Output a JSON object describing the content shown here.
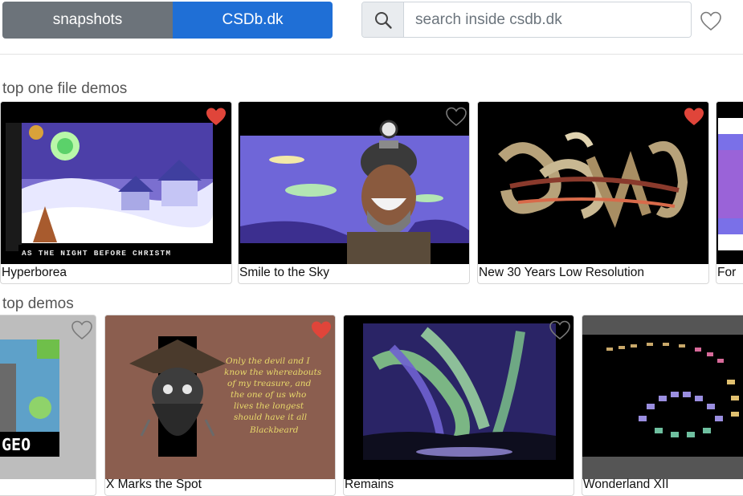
{
  "header": {
    "snapshots_label": "snapshots",
    "csdb_label": "CSDb.dk",
    "search_placeholder": "search inside csdb.dk"
  },
  "sections": [
    {
      "title": "top one file demos",
      "items": [
        {
          "title": "Hyperborea",
          "favorited": true
        },
        {
          "title": "Smile to the Sky",
          "favorited": false
        },
        {
          "title": "New 30 Years Low Resolution",
          "favorited": true
        },
        {
          "title": "For",
          "favorited": false
        }
      ]
    },
    {
      "title": "top demos",
      "items": [
        {
          "title": "",
          "favorited": false
        },
        {
          "title": "X Marks the Spot",
          "favorited": true
        },
        {
          "title": "Remains",
          "favorited": false
        },
        {
          "title": "Wonderland XII",
          "favorited": false
        }
      ]
    }
  ],
  "thumb_texts": {
    "hyperborea_banner": "AS THE NIGHT BEFORE CHRISTM",
    "quote_lines": [
      "Only the devil and I",
      "know the whereabouts",
      "of my treasure, and",
      "the one of us who",
      "lives the longest",
      "should have it all"
    ],
    "quote_author": "Blackbeard",
    "geo_text": "GEO"
  },
  "colors": {
    "csdb_blue": "#1f6fd6",
    "snapshots_gray": "#6c737a",
    "heart_favorited": "#e0453a",
    "heart_outline": "#7a7a7a"
  },
  "icons": {
    "search": "search-icon",
    "heart": "heart-icon"
  }
}
